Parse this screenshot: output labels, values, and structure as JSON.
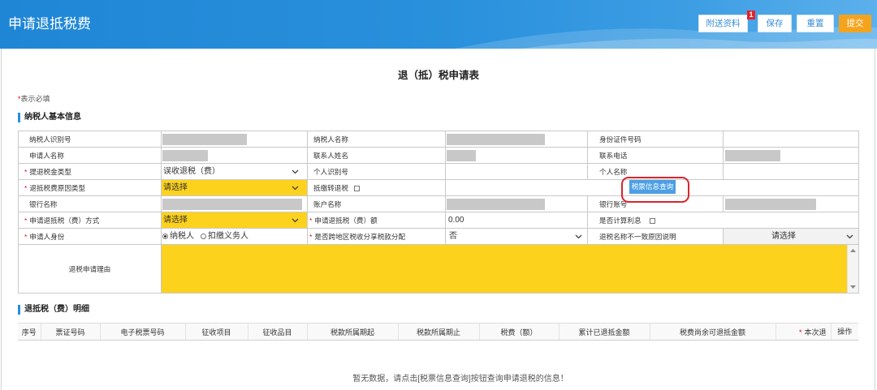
{
  "header": {
    "title": "申请退抵税费",
    "attach_label": "附送资料",
    "attach_badge": "1",
    "save_label": "保存",
    "reset_label": "重置",
    "submit_label": "提交"
  },
  "form": {
    "title": "退（抵）税申请表",
    "required_mark": "*",
    "required_note": "表示必填"
  },
  "basic_info": {
    "title": "纳税人基本信息",
    "taxpayer_id_label": "纳税人识别号",
    "taxpayer_name_label": "纳税人名称",
    "id_document_number_label": "身份证件号码",
    "applicant_name_label": "申请人名称",
    "contact_name_label": "联系人姓名",
    "contact_phone_label": "联系电话",
    "refund_tax_type": {
      "label": "提退税金类型",
      "value": "误收退税（费）",
      "required": true
    },
    "personal_id_label": "个人识别号",
    "personal_name_label": "个人名称",
    "refund_reason_type": {
      "label": "退抵税费原因类型",
      "value": "请选择",
      "required": true
    },
    "offset_to_refund": {
      "label": "抵缴转退税",
      "checked": false
    },
    "ticket_query_button": "税票信息查询",
    "bank_name_label": "银行名称",
    "account_name_label": "账户名称",
    "bank_account_label": "银行账号",
    "refund_method": {
      "label": "申请退抵税（费）方式",
      "value": "请选择",
      "required": true
    },
    "refund_amount": {
      "label": "申请退抵税（费）额",
      "value": "0.00",
      "required": true
    },
    "calculate_interest": {
      "label": "是否计算利息",
      "checked": false
    },
    "applicant_identity": {
      "label": "申请人身份",
      "options": [
        "纳税人",
        "扣缴义务人"
      ],
      "selected_index": 0,
      "required": true
    },
    "cross_region_allocation": {
      "label": "是否跨地区税收分享税款分配",
      "value": "否",
      "required": true
    },
    "name_mismatch_reason": {
      "label": "退税名称不一致原因说明",
      "value": "请选择"
    },
    "application_reason": {
      "label": "退税申请理由",
      "value": ""
    }
  },
  "detail": {
    "title": "退抵税（费）明细",
    "columns": [
      "序号",
      "票证号码",
      "电子税票号码",
      "征收项目",
      "征收品目",
      "税款所属期起",
      "税款所属期止",
      "税费（额）",
      "累计已退抵金额",
      "税费尚余可退抵金额",
      "本次退",
      "操作"
    ],
    "rows": [],
    "empty_message": "暂无数据，请点击[税票信息查询]按钮查询申请退税的信息！"
  },
  "theme": {
    "header_blue": "#2a8edb",
    "required_red": "#e60012",
    "highlight_yellow": "#fdd21d",
    "submit_orange": "#f5a31d",
    "annotation_red": "#d9252d",
    "button_blue": "#4c9fe4"
  },
  "icons": {
    "select": "chevron-down-icon",
    "scroll_up": "scroll-up-arrow-icon",
    "scroll_down": "scroll-down-arrow-icon",
    "checkbox": "checkbox-icon",
    "radio": "radio-icon"
  }
}
